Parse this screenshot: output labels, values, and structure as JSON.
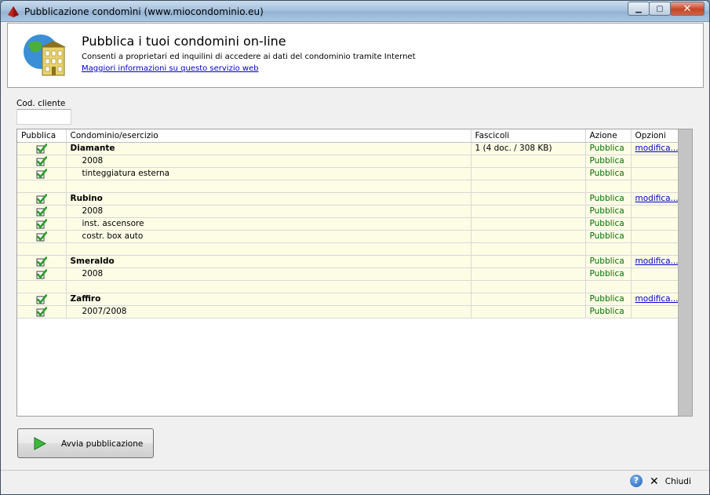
{
  "window": {
    "title": "Pubblicazione condomìni (www.miocondominio.eu)"
  },
  "header": {
    "title": "Pubblica i tuoi condomini on-line",
    "subtitle": "Consenti a proprietari ed inquilini di accedere ai dati del condominio tramite Internet",
    "link": "Maggiori informazioni su questo servizio web"
  },
  "cod_cliente": {
    "label": "Cod. cliente",
    "value": ""
  },
  "grid": {
    "columns": [
      "Pubblica",
      "Condominio/esercizio",
      "Fascicoli",
      "Azione",
      "Opzioni"
    ],
    "rows": [
      {
        "checked": true,
        "name": "Diamante",
        "bold": true,
        "indent": false,
        "fascicoli": "1 (4 doc. / 308 KB)",
        "azione": "Pubblica",
        "opzioni": "modifica..."
      },
      {
        "checked": true,
        "name": "2008",
        "bold": false,
        "indent": true,
        "fascicoli": "",
        "azione": "Pubblica",
        "opzioni": ""
      },
      {
        "checked": true,
        "name": "tinteggiatura esterna",
        "bold": false,
        "indent": true,
        "fascicoli": "",
        "azione": "Pubblica",
        "opzioni": ""
      },
      {
        "blank": true
      },
      {
        "checked": true,
        "name": "Rubino",
        "bold": true,
        "indent": false,
        "fascicoli": "",
        "azione": "Pubblica",
        "opzioni": "modifica..."
      },
      {
        "checked": true,
        "name": "2008",
        "bold": false,
        "indent": true,
        "fascicoli": "",
        "azione": "Pubblica",
        "opzioni": ""
      },
      {
        "checked": true,
        "name": "inst. ascensore",
        "bold": false,
        "indent": true,
        "fascicoli": "",
        "azione": "Pubblica",
        "opzioni": ""
      },
      {
        "checked": true,
        "name": "costr. box auto",
        "bold": false,
        "indent": true,
        "fascicoli": "",
        "azione": "Pubblica",
        "opzioni": ""
      },
      {
        "blank": true
      },
      {
        "checked": true,
        "name": "Smeraldo",
        "bold": true,
        "indent": false,
        "fascicoli": "",
        "azione": "Pubblica",
        "opzioni": "modifica..."
      },
      {
        "checked": true,
        "name": "2008",
        "bold": false,
        "indent": true,
        "fascicoli": "",
        "azione": "Pubblica",
        "opzioni": ""
      },
      {
        "blank": true
      },
      {
        "checked": true,
        "name": "Zaffiro",
        "bold": true,
        "indent": false,
        "fascicoli": "",
        "azione": "Pubblica",
        "opzioni": "modifica..."
      },
      {
        "checked": true,
        "name": "2007/2008",
        "bold": false,
        "indent": true,
        "fascicoli": "",
        "azione": "Pubblica",
        "opzioni": ""
      }
    ]
  },
  "buttons": {
    "start": "Avvia pubblicazione",
    "close": "Chiudi"
  },
  "colors": {
    "row_bg": "#fdfde6",
    "action": "#007000",
    "link": "#0000cc",
    "check": "#2e9e2e"
  }
}
